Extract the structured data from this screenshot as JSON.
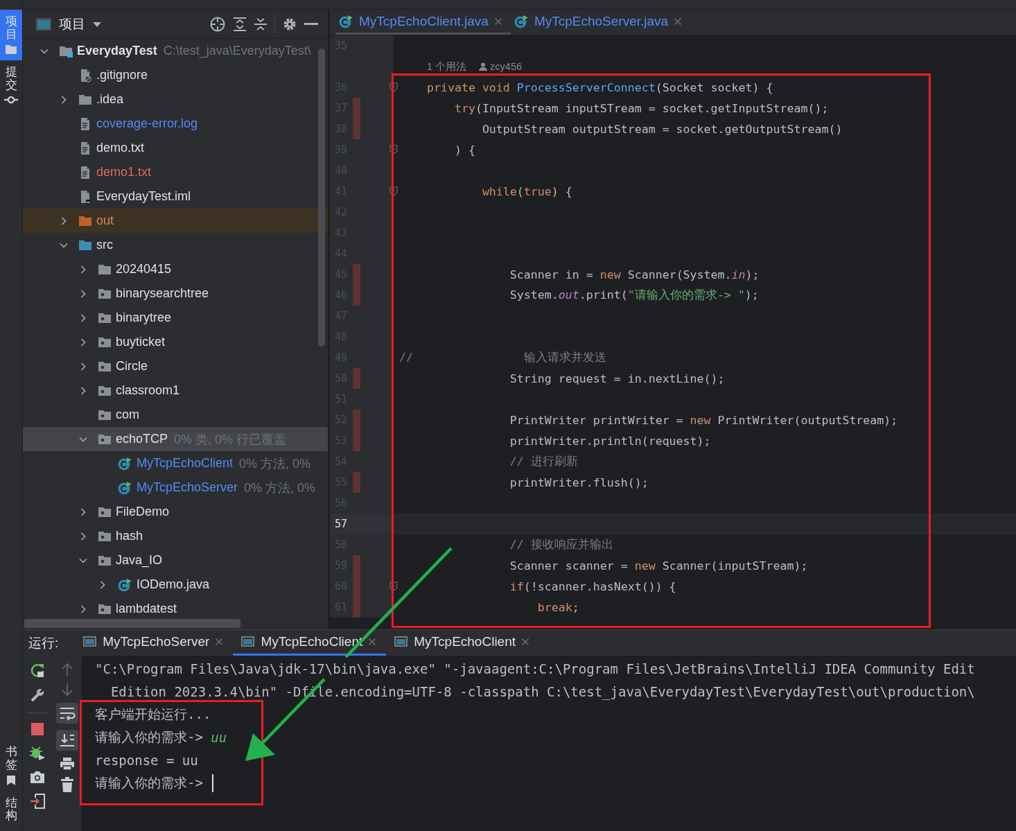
{
  "tool_stripe": {
    "top": [
      {
        "label": "项目",
        "selected": true
      },
      {
        "label": "提交",
        "selected": false
      }
    ],
    "bottom": [
      {
        "label": "书签",
        "selected": false
      },
      {
        "label": "结构",
        "selected": false
      }
    ]
  },
  "project": {
    "title": "项目",
    "tree": [
      {
        "label": "EverydayTest",
        "kind": "project",
        "hint": "C:\\test_java\\EverydayTest\\",
        "expanded": true,
        "selected": false,
        "children": [
          {
            "label": ".gitignore",
            "kind": "ignore-file",
            "selected": false
          },
          {
            "label": ".idea",
            "kind": "folder",
            "expanded": false,
            "selected": false
          },
          {
            "label": "coverage-error.log",
            "kind": "text-file",
            "color": "#548af7",
            "selected": false
          },
          {
            "label": "demo.txt",
            "kind": "text-file",
            "selected": false
          },
          {
            "label": "demo1.txt",
            "kind": "text-file",
            "color": "#e2695f",
            "selected": false
          },
          {
            "label": "EverydayTest.iml",
            "kind": "module-file",
            "selected": false
          },
          {
            "label": "out",
            "kind": "excluded-folder",
            "color": "#d48a4c",
            "expanded": false,
            "selected": false
          },
          {
            "label": "src",
            "kind": "source-folder",
            "expanded": true,
            "selected": false,
            "children": [
              {
                "label": "20240415",
                "kind": "folder",
                "expanded": false,
                "selected": false
              },
              {
                "label": "binarysearchtree",
                "kind": "package",
                "expanded": false,
                "selected": false
              },
              {
                "label": "binarytree",
                "kind": "package",
                "expanded": false,
                "selected": false
              },
              {
                "label": "buyticket",
                "kind": "package",
                "expanded": false,
                "selected": false
              },
              {
                "label": "Circle",
                "kind": "package",
                "expanded": false,
                "selected": false
              },
              {
                "label": "classroom1",
                "kind": "package",
                "expanded": false,
                "selected": false
              },
              {
                "label": "com",
                "kind": "package",
                "selected": false
              },
              {
                "label": "echoTCP",
                "kind": "package",
                "hint": "0% 类, 0% 行已覆盖",
                "expanded": true,
                "selected": true,
                "children": [
                  {
                    "label": "MyTcpEchoClient",
                    "kind": "java-class",
                    "color": "#548af7",
                    "hint": "0% 方法, 0%",
                    "selected": false
                  },
                  {
                    "label": "MyTcpEchoServer",
                    "kind": "java-class",
                    "color": "#548af7",
                    "hint": "0% 方法, 0%",
                    "selected": false
                  }
                ]
              },
              {
                "label": "FileDemo",
                "kind": "package",
                "expanded": false,
                "selected": false
              },
              {
                "label": "hash",
                "kind": "package",
                "expanded": false,
                "selected": false
              },
              {
                "label": "Java_IO",
                "kind": "package",
                "expanded": true,
                "selected": false,
                "children": [
                  {
                    "label": "IODemo.java",
                    "kind": "java-class",
                    "expanded": false,
                    "selected": false
                  }
                ]
              },
              {
                "label": "lambdatest",
                "kind": "package",
                "expanded": false,
                "selected": false
              }
            ]
          }
        ]
      }
    ]
  },
  "editor": {
    "tabs": [
      {
        "label": "MyTcpEchoClient.java",
        "selected": true
      },
      {
        "label": "MyTcpEchoServer.java",
        "selected": false
      }
    ],
    "lines": [
      {
        "kind": "code",
        "number": "35",
        "changed": false,
        "fold": false,
        "current": false
      },
      {
        "kind": "inlay",
        "usages": "1 个用法",
        "author": "zcy456"
      },
      {
        "kind": "code",
        "number": "36",
        "tokens": [
          {
            "text": "    private void ",
            "kind": "keyword"
          },
          {
            "text": "ProcessServerConnect",
            "kind": "declaration"
          },
          {
            "text": "(Socket socket) {",
            "kind": "plain"
          }
        ],
        "changed": false,
        "fold": true,
        "current": false
      },
      {
        "kind": "code",
        "number": "37",
        "tokens": [
          {
            "text": "        try",
            "kind": "keyword"
          },
          {
            "text": "(InputStream inputSTream = socket.getInputStream();",
            "kind": "plain"
          }
        ],
        "changed": true,
        "fold": false,
        "current": false
      },
      {
        "kind": "code",
        "number": "38",
        "tokens": [
          {
            "text": "            OutputStream outputStream = socket.getOutputStream()",
            "kind": "plain"
          }
        ],
        "changed": true,
        "fold": false,
        "current": false
      },
      {
        "kind": "code",
        "number": "39",
        "tokens": [
          {
            "text": "        ) {",
            "kind": "plain"
          }
        ],
        "changed": false,
        "fold": true,
        "current": false
      },
      {
        "kind": "code",
        "number": "40",
        "changed": false,
        "fold": false,
        "current": false
      },
      {
        "kind": "code",
        "number": "41",
        "tokens": [
          {
            "text": "            while",
            "kind": "keyword"
          },
          {
            "text": "(",
            "kind": "plain"
          },
          {
            "text": "true",
            "kind": "keyword"
          },
          {
            "text": ") {",
            "kind": "plain"
          }
        ],
        "changed": false,
        "fold": true,
        "current": false
      },
      {
        "kind": "code",
        "number": "42",
        "changed": false,
        "fold": false,
        "current": false
      },
      {
        "kind": "code",
        "number": "43",
        "changed": false,
        "fold": false,
        "current": false
      },
      {
        "kind": "code",
        "number": "44",
        "changed": false,
        "fold": false,
        "current": false
      },
      {
        "kind": "code",
        "number": "45",
        "tokens": [
          {
            "text": "                Scanner in = ",
            "kind": "plain"
          },
          {
            "text": "new",
            "kind": "keyword"
          },
          {
            "text": " Scanner(System.",
            "kind": "plain"
          },
          {
            "text": "in",
            "kind": "field"
          },
          {
            "text": ");",
            "kind": "plain"
          }
        ],
        "changed": true,
        "fold": false,
        "current": false
      },
      {
        "kind": "code",
        "number": "46",
        "tokens": [
          {
            "text": "                System.",
            "kind": "plain"
          },
          {
            "text": "out",
            "kind": "field"
          },
          {
            "text": ".print(",
            "kind": "plain"
          },
          {
            "text": "\"请输入你的需求-> \"",
            "kind": "string"
          },
          {
            "text": ");",
            "kind": "plain"
          }
        ],
        "changed": true,
        "fold": false,
        "current": false
      },
      {
        "kind": "code",
        "number": "47",
        "changed": false,
        "fold": false,
        "current": false
      },
      {
        "kind": "code",
        "number": "48",
        "changed": false,
        "fold": false,
        "current": false
      },
      {
        "kind": "code",
        "number": "49",
        "tokens": [
          {
            "text": "//                输入请求并发送",
            "kind": "comment"
          }
        ],
        "changed": false,
        "fold": false,
        "current": false
      },
      {
        "kind": "code",
        "number": "50",
        "tokens": [
          {
            "text": "                String request = in.nextLine();",
            "kind": "plain"
          }
        ],
        "changed": true,
        "fold": false,
        "current": false
      },
      {
        "kind": "code",
        "number": "51",
        "changed": false,
        "fold": false,
        "current": false
      },
      {
        "kind": "code",
        "number": "52",
        "tokens": [
          {
            "text": "                PrintWriter printWriter = ",
            "kind": "plain"
          },
          {
            "text": "new",
            "kind": "keyword"
          },
          {
            "text": " PrintWriter(outputStream);",
            "kind": "plain"
          }
        ],
        "changed": true,
        "fold": false,
        "current": false
      },
      {
        "kind": "code",
        "number": "53",
        "tokens": [
          {
            "text": "                printWriter.println(request);",
            "kind": "plain"
          }
        ],
        "changed": true,
        "fold": false,
        "current": false
      },
      {
        "kind": "code",
        "number": "54",
        "tokens": [
          {
            "text": "                // 进行刷新",
            "kind": "comment"
          }
        ],
        "changed": false,
        "fold": false,
        "current": false
      },
      {
        "kind": "code",
        "number": "55",
        "tokens": [
          {
            "text": "                printWriter.flush();",
            "kind": "plain"
          }
        ],
        "changed": true,
        "fold": false,
        "current": false
      },
      {
        "kind": "code",
        "number": "56",
        "changed": false,
        "fold": false,
        "current": false
      },
      {
        "kind": "code",
        "number": "57",
        "changed": false,
        "fold": false,
        "current": true
      },
      {
        "kind": "code",
        "number": "58",
        "tokens": [
          {
            "text": "                // 接收响应并输出",
            "kind": "comment"
          }
        ],
        "changed": false,
        "fold": false,
        "current": false
      },
      {
        "kind": "code",
        "number": "59",
        "tokens": [
          {
            "text": "                Scanner scanner = ",
            "kind": "plain"
          },
          {
            "text": "new",
            "kind": "keyword"
          },
          {
            "text": " Scanner(inputSTream);",
            "kind": "plain"
          }
        ],
        "changed": true,
        "fold": false,
        "current": false
      },
      {
        "kind": "code",
        "number": "60",
        "tokens": [
          {
            "text": "                if",
            "kind": "keyword"
          },
          {
            "text": "(!scanner.hasNext()) {",
            "kind": "plain"
          }
        ],
        "changed": true,
        "fold": true,
        "current": false
      },
      {
        "kind": "code",
        "number": "61",
        "tokens": [
          {
            "text": "                    break",
            "kind": "keyword"
          },
          {
            "text": ";",
            "kind": "plain"
          }
        ],
        "changed": true,
        "fold": false,
        "current": false
      }
    ]
  },
  "run": {
    "label": "运行:",
    "tabs": [
      {
        "label": "MyTcpEchoServer",
        "selected": false
      },
      {
        "label": "MyTcpEchoClient",
        "selected": true
      },
      {
        "label": "MyTcpEchoClient",
        "selected": false
      }
    ],
    "soft_wrap_on": true,
    "scroll_to_end_on": true,
    "console": {
      "cursor": true,
      "lines": [
        {
          "segments": [
            {
              "text": "\"C:\\Program Files\\Java\\jdk-17\\bin\\java.exe\" \"-javaagent:C:\\Program Files\\JetBrains\\IntelliJ IDEA Community Edit",
              "kind": "output"
            }
          ]
        },
        {
          "segments": [
            {
              "text": "  Edition 2023.3.4\\bin\" -Dfile.encoding=UTF-8 -classpath C:\\test_java\\EverydayTest\\EverydayTest\\out\\production\\",
              "kind": "output"
            }
          ]
        },
        {
          "segments": [
            {
              "text": "客户端开始运行...",
              "kind": "output"
            }
          ]
        },
        {
          "segments": [
            {
              "text": "请输入你的需求-> ",
              "kind": "output"
            },
            {
              "text": "uu",
              "kind": "input"
            }
          ]
        },
        {
          "segments": [
            {
              "text": "response = uu",
              "kind": "output"
            }
          ]
        },
        {
          "segments": [
            {
              "text": "请输入你的需求-> ",
              "kind": "output"
            }
          ]
        }
      ]
    }
  },
  "annotations": [
    {
      "kind": "frame"
    },
    {
      "kind": "frame"
    },
    {
      "kind": "arrow"
    }
  ]
}
